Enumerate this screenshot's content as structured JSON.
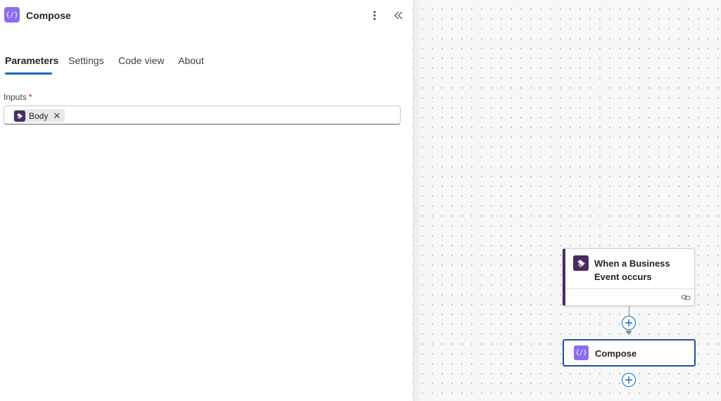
{
  "panel": {
    "title": "Compose",
    "icon": "compose-icon",
    "icon_glyph": "{/}",
    "accent_color": "#8c6cf0"
  },
  "tabs": [
    {
      "label": "Parameters",
      "active": true
    },
    {
      "label": "Settings",
      "active": false
    },
    {
      "label": "Code view",
      "active": false
    },
    {
      "label": "About",
      "active": false
    }
  ],
  "inputs_field": {
    "label": "Inputs",
    "required_mark": "*",
    "token": {
      "label": "Body",
      "icon": "business-event-icon",
      "color": "#4b2c61"
    }
  },
  "canvas": {
    "trigger_node": {
      "title": "When a Business Event occurs",
      "icon": "business-event-icon",
      "color": "#4b2c61"
    },
    "compose_node": {
      "title": "Compose",
      "icon": "compose-icon",
      "icon_glyph": "{/}",
      "selected_border": "#1f4fa8"
    }
  }
}
